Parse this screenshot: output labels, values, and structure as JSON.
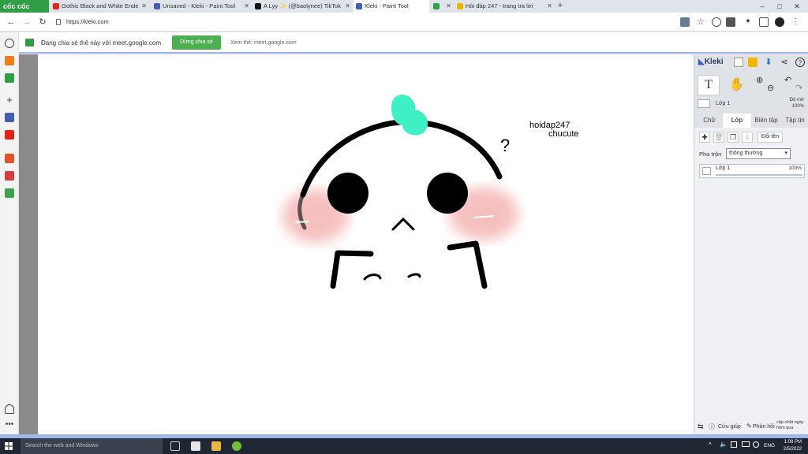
{
  "browser": {
    "brand_label": "cốc cốc",
    "tabs": [
      {
        "label": "Gothic Black and White Ende",
        "icon_color": "#e62117",
        "active": false
      },
      {
        "label": "Unsaved - Kleki - Paint Tool",
        "icon_color": "#3f5fb5",
        "active": false
      },
      {
        "label": "A Lyy ✨ (@baolynee) TikTok",
        "icon_color": "#111111",
        "active": false
      },
      {
        "label": "Kleki - Paint Tool",
        "icon_color": "#3f5fb5",
        "active": true
      },
      {
        "label": "",
        "icon_color": "#2f9e44",
        "active": false
      },
      {
        "label": "Hỏi đáp 247 - trang tra lời",
        "icon_color": "#f0b400",
        "active": false
      }
    ],
    "new_tab_label": "+",
    "url": "https://kleki.com",
    "window_buttons": {
      "minimize": "–",
      "maximize": "□",
      "close": "✕"
    }
  },
  "share_bar": {
    "text": "Đang chia sẻ thẻ này với meet.google.com",
    "stop_label": "Dừng chia sẻ",
    "view_label": "Xem thẻ: meet.google.com",
    "accent_color": "#4caf50"
  },
  "kleki": {
    "logo": "Kleki",
    "layer_strip": {
      "name": "Lớp 1",
      "opacity_title": "Độ mờ",
      "opacity_value": "100%"
    },
    "tabs": [
      "Chữ",
      "Lớp",
      "Biên tập",
      "Tập tin"
    ],
    "active_tab": "Lớp",
    "rename_label": "Đổi tên",
    "blend_label": "Pha trộn",
    "blend_value": "thông thường",
    "layer": {
      "name": "Lớp 1",
      "opacity": "100%"
    },
    "footer": {
      "help_label": "Cứu giúp",
      "feedback_label": "Phản hồi",
      "update_label": "cập nhật ngày hôm qua"
    }
  },
  "drawing": {
    "label_line1": "hoidap247",
    "label_line2": "chucute",
    "question_mark": "?",
    "colors": {
      "stroke": "#000000",
      "bow": "#3ef0c4",
      "blush": "#f4b5b5"
    }
  },
  "taskbar": {
    "search_placeholder": "Search the web and Windows",
    "lang": "ENG",
    "time": "1:08 PM",
    "date": "2/5/2022"
  }
}
